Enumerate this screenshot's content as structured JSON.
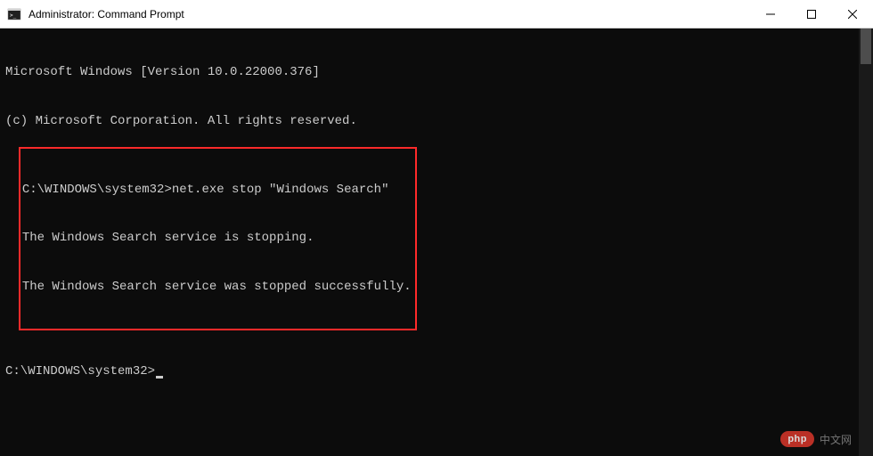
{
  "titlebar": {
    "title": "Administrator: Command Prompt"
  },
  "terminal": {
    "header_line1": "Microsoft Windows [Version 10.0.22000.376]",
    "header_line2": "(c) Microsoft Corporation. All rights reserved.",
    "highlighted": {
      "prompt": "C:\\WINDOWS\\system32>",
      "command": "net.exe stop \"Windows Search\"",
      "output_line1": "The Windows Search service is stopping.",
      "output_line2": "The Windows Search service was stopped successfully."
    },
    "current_prompt": "C:\\WINDOWS\\system32>"
  },
  "watermark": {
    "badge": "php",
    "text": "中文网"
  }
}
